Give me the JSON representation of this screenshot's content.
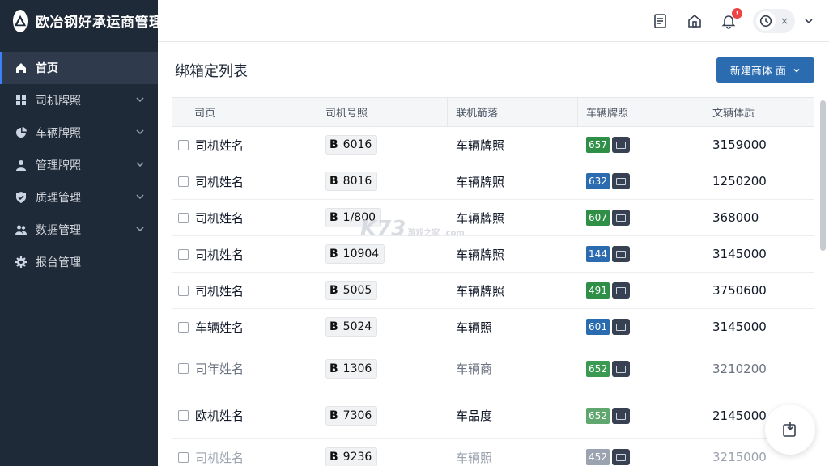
{
  "app": {
    "title": "欧冶钢好承运商管理后台"
  },
  "header": {
    "notification_count": "!",
    "user_close": "×"
  },
  "sidebar": {
    "items": [
      {
        "label": "首页",
        "icon": "home-icon",
        "active": true
      },
      {
        "label": "司机牌照",
        "icon": "grid-icon"
      },
      {
        "label": "车辆牌照",
        "icon": "chart-pie-icon"
      },
      {
        "label": "管理牌照",
        "icon": "user-icon"
      },
      {
        "label": "质理管理",
        "icon": "shield-check-icon"
      },
      {
        "label": "数据管理",
        "icon": "users-icon"
      },
      {
        "label": "报台管理",
        "icon": "gear-icon"
      }
    ]
  },
  "main": {
    "page_title": "绑箱定列表",
    "new_button": "新建商体 面",
    "columns": [
      "司页",
      "司机号照",
      "联机箭落",
      "车辆牌照",
      "文辆体质"
    ],
    "rows": [
      {
        "name": "司机姓名",
        "plate": "6016",
        "vehicle": "车辆牌照",
        "tag": "657",
        "tag_color": "#2f8f47",
        "amount": "3159000"
      },
      {
        "name": "司机姓名",
        "plate": "8016",
        "vehicle": "车辆牌照",
        "tag": "632",
        "tag_color": "#2b6cb0",
        "amount": "1250200"
      },
      {
        "name": "司机姓名",
        "plate": "1/800",
        "vehicle": "车辆牌照",
        "tag": "607",
        "tag_color": "#2f8f47",
        "amount": "368000"
      },
      {
        "name": "司机姓名",
        "plate": "10904",
        "vehicle": "车辆牌照",
        "tag": "144",
        "tag_color": "#2b6cb0",
        "amount": "3145000"
      },
      {
        "name": "司机姓名",
        "plate": "5005",
        "vehicle": "车辆牌照",
        "tag": "491",
        "tag_color": "#2f8f47",
        "amount": "3750600"
      },
      {
        "name": "车辆姓名",
        "plate": "5024",
        "vehicle": "车辆照",
        "tag": "601",
        "tag_color": "#2b6cb0",
        "amount": "3145000"
      },
      {
        "name": "司年姓名",
        "plate": "1306",
        "vehicle": "车辆商",
        "tag": "652",
        "tag_color": "#3a9a52",
        "amount": "3210200"
      },
      {
        "name": "欧机姓名",
        "plate": "7306",
        "vehicle": "车品度",
        "tag": "652",
        "tag_color": "#5fa66f",
        "amount": "2145000"
      },
      {
        "name": "司机姓名",
        "plate": "9236",
        "vehicle": "车辆照",
        "tag": "452",
        "tag_color": "#9aa3af",
        "amount": "3215000"
      }
    ]
  },
  "watermark": {
    "main": "K73",
    "sub": "游戏之家 .com"
  }
}
